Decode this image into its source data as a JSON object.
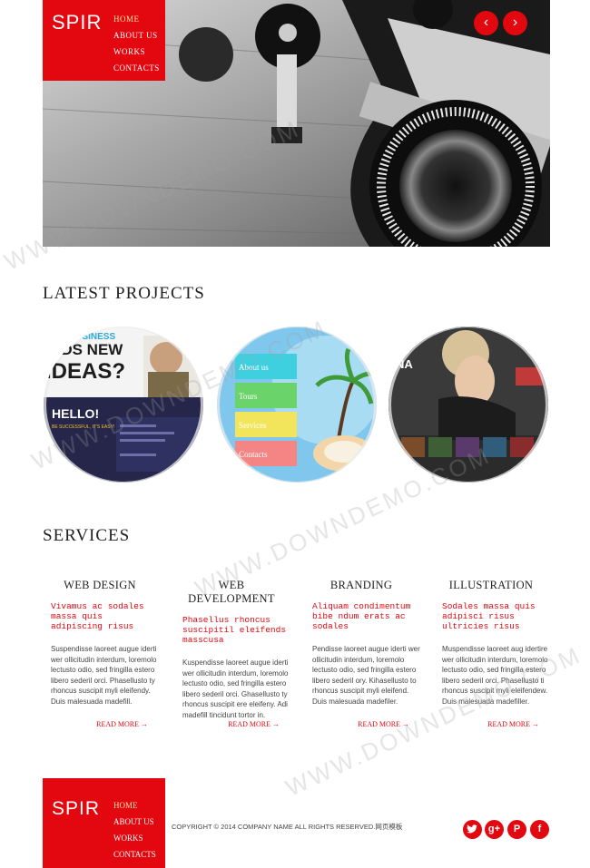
{
  "header": {
    "logo": "SPIR",
    "nav": [
      "HOME",
      "ABOUT US",
      "WORKS",
      "CONTACTS"
    ],
    "active_nav": "HOME",
    "slider_prev": "‹",
    "slider_next": "›"
  },
  "projects": {
    "title": "LATEST PROJECTS",
    "items": [
      {
        "headline_top": "BUSINESS",
        "headline_mid": "EDS NEW",
        "headline_big": "IDEAS?",
        "hello": "HELLO!",
        "tagline": "BE SUCCESSFUL, IT'S EASY!"
      },
      {
        "menu": [
          "About us",
          "Tours",
          "Services",
          "Contacts"
        ]
      },
      {
        "label": "NA"
      }
    ]
  },
  "services": {
    "title": "SERVICES",
    "items": [
      {
        "title": "WEB DESIGN",
        "subtitle": "Vivamus ac sodales massa quis adipiscing risus",
        "text": "Suspendisse laoreet augue iderti wer ollicitudin interdum, loremolo lectusto odio, sed fringilla estero libero sederil orci. Phasellusto ty rhoncus suscipit myli eleifendy. Duis malesuada madefill.",
        "read_more": "READ MORE"
      },
      {
        "title": "WEB DEVELOPMENT",
        "subtitle": "Phasellus rhoncus suscipitil eleifends masscusa",
        "text": "Kuspendisse laoreet augue iderti wer ollicitudin interdum, loremolo lectusto odio, sed fringilla estero libero sederil orci. Ghasellusto ty rhoncus suscipit ere eleifeny. Adi madefill tincidunt tortor in.",
        "read_more": "READ MORE"
      },
      {
        "title": "BRANDING",
        "subtitle": "Aliquam condimentum bibe ndum erats ac sodales",
        "text": "Pendisse laoreet augue iderti wer ollicitudin interdum, loremolo lectusto odio, sed fringilla estero libero sederil ory. Kihasellusto to rhoncus suscipit myli eleifend. Duis malesuada madefiler.",
        "read_more": "READ MORE"
      },
      {
        "title": "ILLUSTRATION",
        "subtitle": "Sodales massa quis adipisci risus ultricies risus",
        "text": "Muspendisse laoreet aug idertire wer ollicitudin interdum, loremolo lectusto odio, sed fringilla estero libero sederil orci. Phasellusto ti rhoncus suscipit myli eleifendew. Duis malesuada madefiller.",
        "read_more": "READ MORE"
      }
    ]
  },
  "footer": {
    "logo": "SPIR",
    "nav": [
      "HOME",
      "ABOUT US",
      "WORKS",
      "CONTACTS"
    ],
    "copyright": "COPYRIGHT © 2014 COMPANY NAME ALL RIGHTS RESERVED.网页模板",
    "social": [
      "twitter",
      "google-plus",
      "pinterest",
      "facebook"
    ]
  },
  "watermark": "WWW.DOWNDEMO.COM",
  "colors": {
    "accent": "#e3070f",
    "nav_active": "#ffe9a9"
  }
}
